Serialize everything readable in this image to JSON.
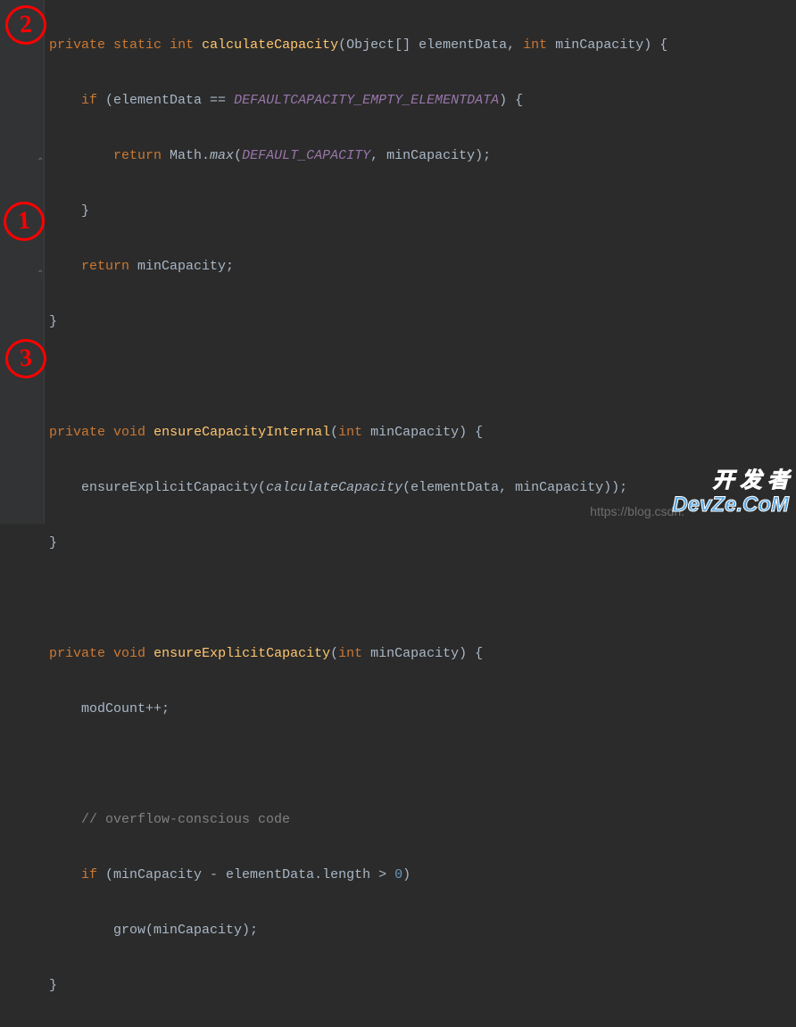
{
  "annotations": {
    "a2": "2",
    "a1": "1",
    "a3": "3"
  },
  "code": {
    "l1_kw1": "private",
    "l1_kw2": "static",
    "l1_kw3": "int",
    "l1_name": "calculateCapacity",
    "l1_p1": "(Object[] elementData, ",
    "l1_kw4": "int",
    "l1_p2": " minCapacity) {",
    "l2_kw1": "if",
    "l2_t1": " (elementData == ",
    "l2_const": "DEFAULTCAPACITY_EMPTY_ELEMENTDATA",
    "l2_t2": ") {",
    "l3_kw1": "return",
    "l3_t1": " Math.",
    "l3_m": "max",
    "l3_t2": "(",
    "l3_const": "DEFAULT_CAPACITY",
    "l3_t3": ", minCapacity);",
    "l4_t": "}",
    "l5_kw1": "return",
    "l5_t1": " minCapacity;",
    "l6_t": "}",
    "l8_kw1": "private",
    "l8_kw2": "void",
    "l8_name": "ensureCapacityInternal",
    "l8_t1": "(",
    "l8_kw3": "int",
    "l8_t2": " minCapacity) {",
    "l9_t1": "ensureExplicitCapacity(",
    "l9_m": "calculateCapacity",
    "l9_t2": "(elementData, minCapacity));",
    "l10_t": "}",
    "l12_kw1": "private",
    "l12_kw2": "void",
    "l12_name": "ensureExplicitCapacity",
    "l12_t1": "(",
    "l12_kw3": "int",
    "l12_t2": " minCapacity) {",
    "l13_t1": "modCount++;",
    "l15_c": "// overflow-conscious code",
    "l16_kw1": "if",
    "l16_t1": " (minCapacity - elementData.length > ",
    "l16_n": "0",
    "l16_t2": ")",
    "l17_t1": "grow(minCapacity);",
    "l18_t": "}"
  },
  "watermark": {
    "url": "https://blog.csdn.",
    "line1": "开 发 者",
    "line2": "DevZe.CoM"
  }
}
